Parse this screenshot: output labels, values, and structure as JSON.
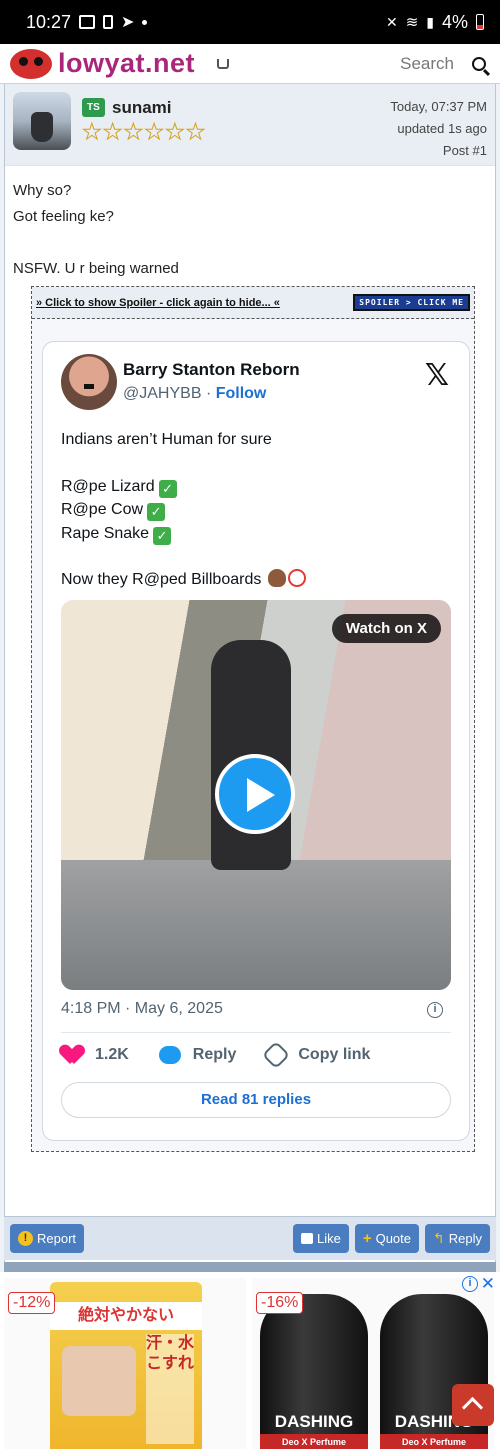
{
  "status_bar": {
    "time": "10:27",
    "battery": "4%"
  },
  "header": {
    "logo_text": "lowyat.net",
    "search_placeholder": "Search"
  },
  "post": {
    "badge": "TS",
    "username": "sunami",
    "timestamp": "Today, 07:37 PM",
    "updated": "updated 1s ago",
    "post_number": "Post #1",
    "rating_stars": 6,
    "body_lines": [
      "Why so?",
      "Got feeling ke?",
      "",
      "NSFW. U r being warned"
    ]
  },
  "spoiler": {
    "link_text": "» Click to show Spoiler - click again to hide... «",
    "button_text": "SPOILER > CLICK ME"
  },
  "tweet": {
    "author_name": "Barry Stanton Reborn",
    "handle": "@JAHYBB",
    "separator": "·",
    "follow_label": "Follow",
    "line1": "Indians aren’t Human for sure",
    "line2": "R@pe Lizard",
    "line3": "R@pe Cow",
    "line4": "Rape Snake",
    "line5": "Now they R@ped Billboards",
    "watch_label": "Watch on X",
    "time": "4:18 PM · May 6, 2025",
    "likes": "1.2K",
    "reply_label": "Reply",
    "copy_label": "Copy link",
    "read_replies": "Read 81 replies"
  },
  "actions": {
    "report": "Report",
    "like": "Like",
    "quote": "Quote",
    "reply": "Reply"
  },
  "ad": {
    "left_discount": "-12%",
    "right_discount": "-16%",
    "left_band": "絶対やかない",
    "left_side": "汗・水こすれ",
    "right_brand": "DASHING",
    "right_stripe": "Deo X Perfume"
  },
  "colors": {
    "brand": "#a8277a",
    "accent": "#4a7cc0",
    "tweet_link": "#1d6fd1"
  }
}
